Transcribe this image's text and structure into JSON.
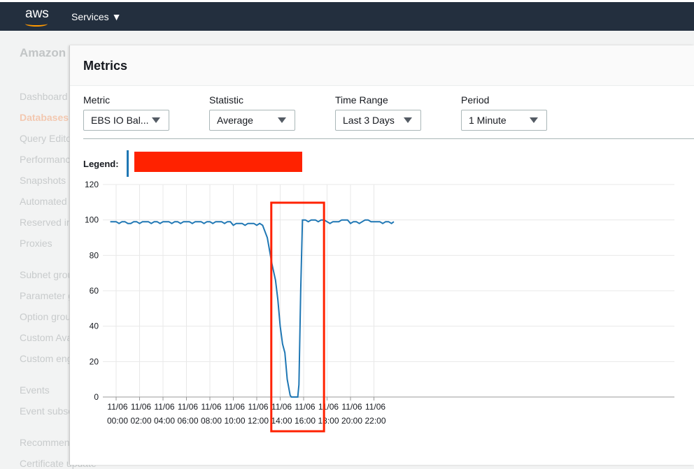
{
  "topbar": {
    "logo": "aws",
    "services": "Services"
  },
  "sidebar": {
    "title": "Amazon RDS",
    "items": [
      "Dashboard",
      "Databases",
      "Query Editor",
      "Performance insights",
      "Snapshots",
      "Automated backups",
      "Reserved instances",
      "Proxies",
      "Subnet groups",
      "Parameter groups",
      "Option groups",
      "Custom Availability",
      "Custom engine versions",
      "Events",
      "Event subscriptions",
      "Recommendations",
      "Certificate update"
    ],
    "active": "Databases"
  },
  "modal": {
    "title": "Metrics",
    "fields": [
      {
        "label": "Metric",
        "value": "EBS IO Bal..."
      },
      {
        "label": "Statistic",
        "value": "Average"
      },
      {
        "label": "Time Range",
        "value": "Last 3 Days"
      },
      {
        "label": "Period",
        "value": "1 Minute"
      }
    ],
    "legend_label": "Legend:"
  },
  "colors": {
    "series": "#1f77b4",
    "highlight": "#ff2200",
    "redaction": "#ff2200"
  },
  "chart_data": {
    "type": "line",
    "ylim": [
      0,
      120
    ],
    "yticks": [
      0,
      20,
      40,
      60,
      80,
      100,
      120
    ],
    "grid": true,
    "xtick_labels": [
      [
        "11/06",
        "00:00"
      ],
      [
        "11/06",
        "02:00"
      ],
      [
        "11/06",
        "04:00"
      ],
      [
        "11/06",
        "06:00"
      ],
      [
        "11/06",
        "08:00"
      ],
      [
        "11/06",
        "10:00"
      ],
      [
        "11/06",
        "12:00"
      ],
      [
        "11/06",
        "14:00"
      ],
      [
        "11/06",
        "16:00"
      ],
      [
        "11/06",
        "18:00"
      ],
      [
        "11/06",
        "20:00"
      ],
      [
        "11/06",
        "22:00"
      ]
    ],
    "x_hours": [
      -0.5,
      1,
      2,
      3,
      4,
      5,
      6,
      7,
      8,
      9,
      10,
      11,
      12,
      12.5,
      12.9,
      13.3,
      13.6,
      13.8,
      14.0,
      14.2,
      14.4,
      14.6,
      14.85,
      14.95,
      15.5,
      15.6,
      15.75,
      15.9,
      17,
      18,
      19,
      20,
      21,
      22,
      23,
      23.7
    ],
    "y": [
      99,
      99,
      99,
      99,
      99,
      99,
      99,
      99,
      99,
      99,
      98,
      98,
      98,
      97,
      90,
      75,
      66,
      55,
      40,
      30,
      25,
      10,
      1,
      0,
      0,
      7,
      60,
      100,
      100,
      99,
      100,
      99,
      100,
      99,
      99,
      99
    ],
    "highlight_hours": [
      13.3,
      17.8
    ]
  }
}
